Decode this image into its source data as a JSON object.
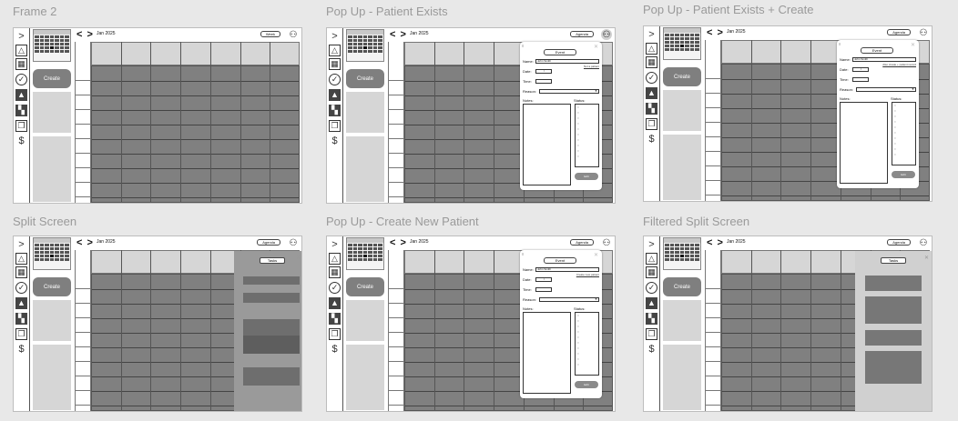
{
  "frames": [
    {
      "title": "Frame 2",
      "view_label": "Week",
      "month": "Jan 2025",
      "create_label": "Create",
      "variant": "plain"
    },
    {
      "title": "Pop Up - Patient Exists",
      "view_label": "Agenda",
      "month": "Jan 2025",
      "create_label": "Create",
      "variant": "popup"
    },
    {
      "title": "Pop Up - Patient Exists + Create",
      "view_label": "Agenda",
      "month": "Jan 2025",
      "create_label": "Create",
      "variant": "popup-create"
    },
    {
      "title": "Split Screen",
      "view_label": "Agenda",
      "month": "Jan 2025",
      "create_label": "Create",
      "variant": "split"
    },
    {
      "title": "Pop Up - Create New Patient",
      "view_label": "Agenda",
      "month": "Jan 2025",
      "create_label": "Create",
      "variant": "popup-new"
    },
    {
      "title": "Filtered Split Screen",
      "view_label": "Agenda",
      "month": "Jan 2025",
      "create_label": "Create",
      "variant": "filtered"
    }
  ],
  "popup": {
    "drag_handle": "≡",
    "close": "✕",
    "title": "Event",
    "name_label": "Name:",
    "name_value": "John Smith",
    "date_label": "Date:",
    "date_value": "/",
    "time_label": "Time:",
    "reason_label": "Reason:",
    "notes_label": "Notes:",
    "status_label": "Status:",
    "edit_label": "Edit",
    "link_patient_exists": "Not a patient",
    "link_patient_create": "Also create + patient record",
    "link_new_patient": "Create new patient"
  },
  "split_panel": {
    "tasks_label": "Tasks",
    "close": "✕"
  },
  "nav_arrows": "< >",
  "rail_icons": [
    {
      "name": "chevron-right-icon",
      "glyph": ">"
    },
    {
      "name": "triangle-icon",
      "glyph": "△"
    },
    {
      "name": "calendar-icon",
      "glyph": "▦"
    },
    {
      "name": "check-circle-icon",
      "glyph": "✓"
    },
    {
      "name": "flask-icon",
      "glyph": "▲"
    },
    {
      "name": "dashboard-icon",
      "glyph": "▚"
    },
    {
      "name": "document-icon",
      "glyph": "❐"
    },
    {
      "name": "dollar-icon",
      "glyph": "$"
    }
  ],
  "avatar_glyph": "⚇",
  "colors": {
    "grid": "#808080",
    "header": "#d6d6d6",
    "panel": "#cfcfcf",
    "button": "#7f7f7f"
  }
}
